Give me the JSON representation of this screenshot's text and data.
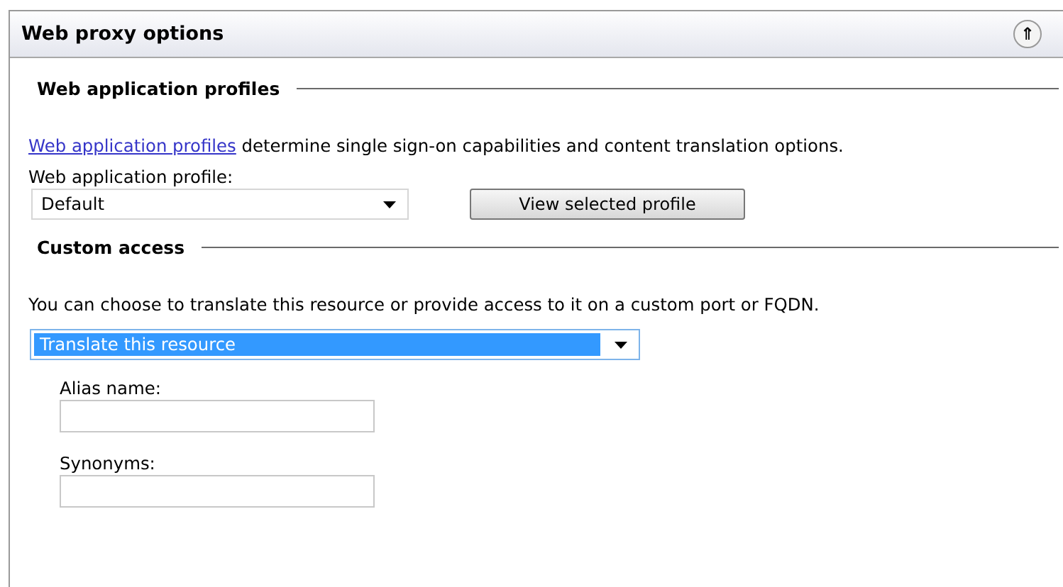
{
  "panel": {
    "title": "Web proxy options",
    "collapse_icon": "⇑"
  },
  "profiles_section": {
    "heading": "Web application profiles",
    "link": "Web application profiles",
    "description": " determine single sign-on capabilities and content translation options.",
    "field_label": "Web application profile:",
    "select_value": "Default",
    "button": "View selected profile"
  },
  "custom_access": {
    "heading": "Custom access",
    "description": "You can choose to translate this resource or provide access to it on a custom port or FQDN.",
    "select_value": "Translate this resource",
    "highlighted": true,
    "fields": [
      {
        "label": "Alias name:"
      },
      {
        "label": "Synonyms:"
      }
    ]
  }
}
